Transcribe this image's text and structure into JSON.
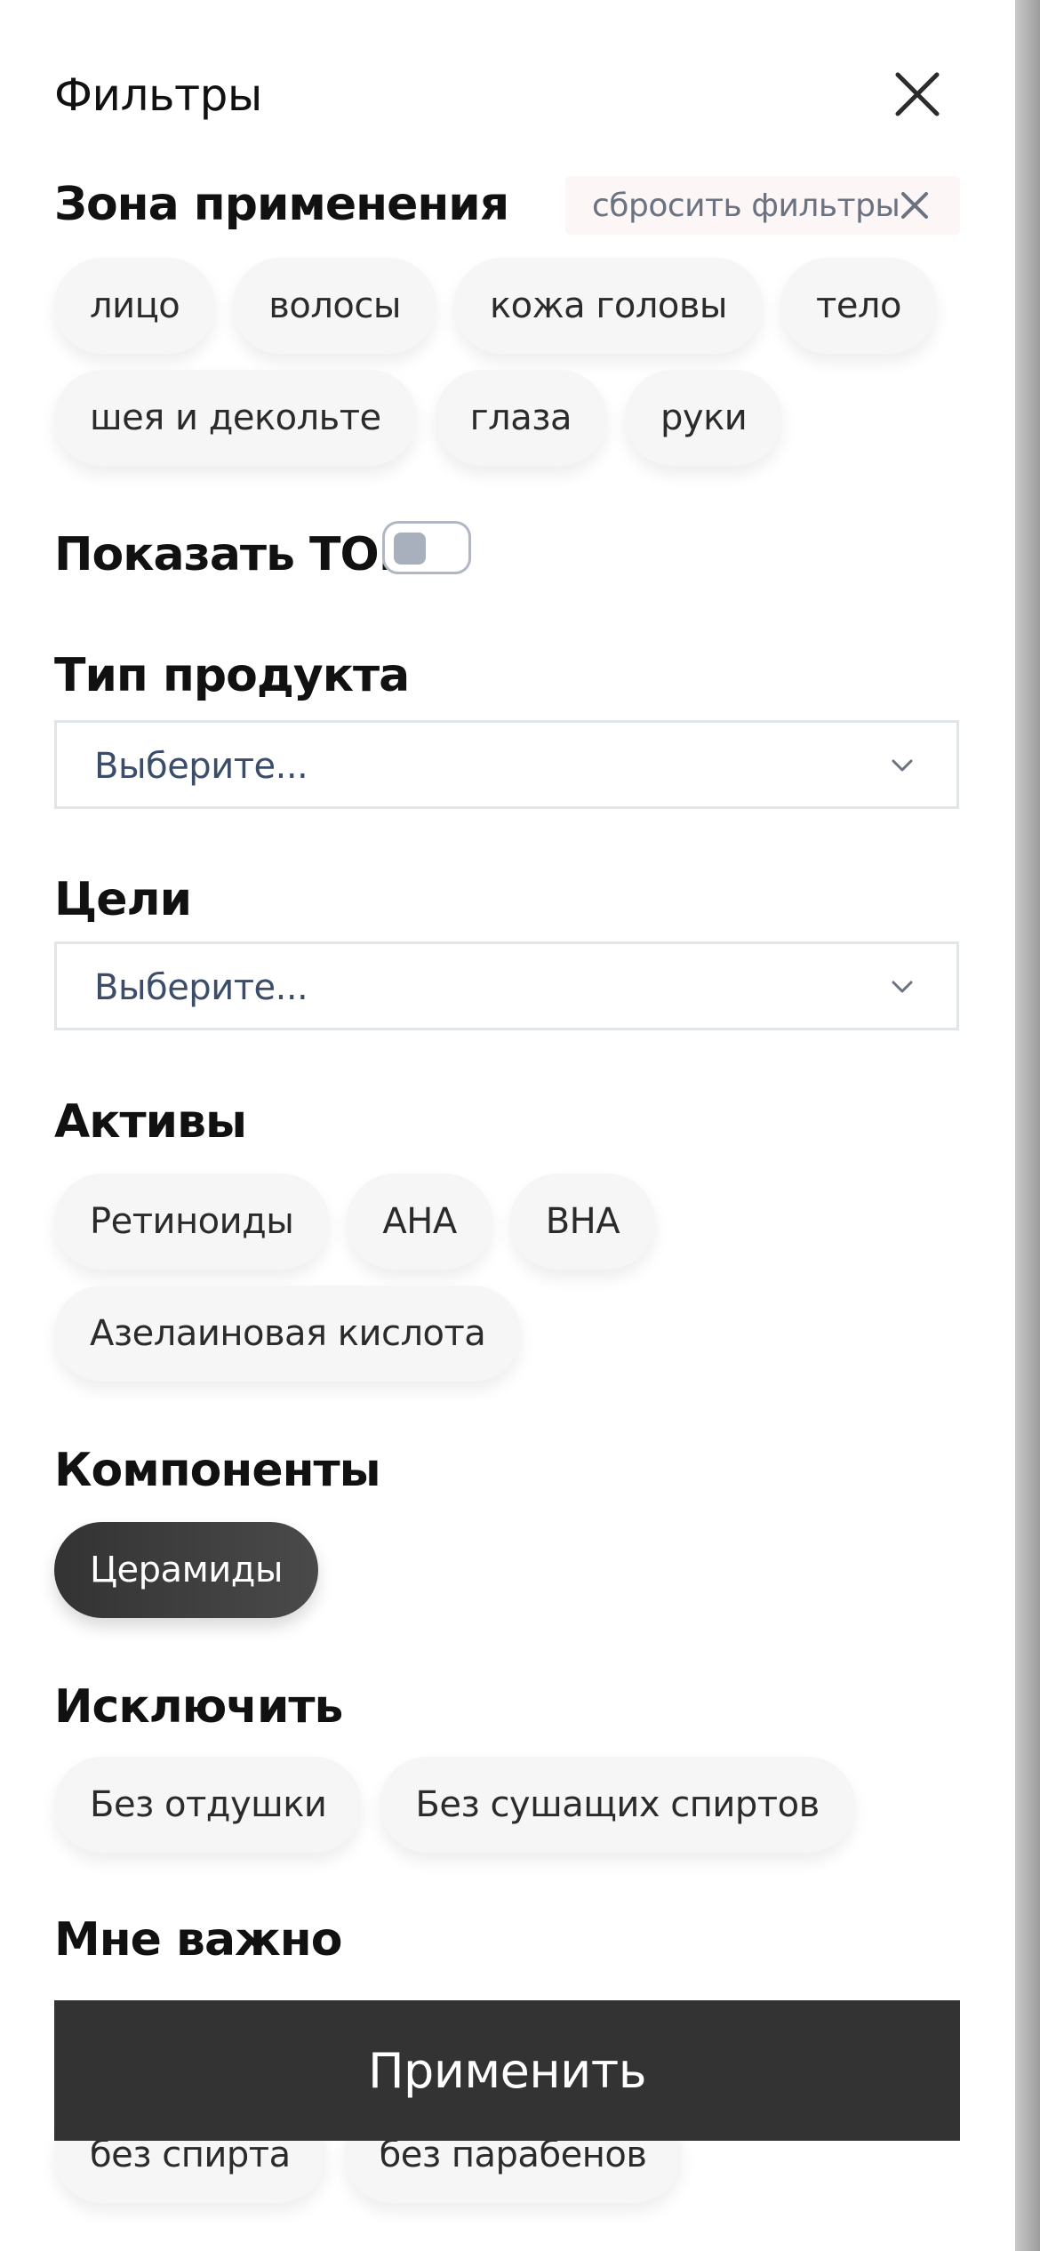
{
  "header": {
    "title": "Фильтры"
  },
  "reset_filters": {
    "label": "сбросить фильтры"
  },
  "zone": {
    "title": "Зона применения",
    "chips": [
      "лицо",
      "волосы",
      "кожа головы",
      "тело",
      "шея и декольте",
      "глаза",
      "руки"
    ]
  },
  "top": {
    "label": "Показать ТОП",
    "checked": false
  },
  "product_type": {
    "title": "Тип продукта",
    "placeholder": "Выберите..."
  },
  "goals": {
    "title": "Цели",
    "placeholder": "Выберите..."
  },
  "actives": {
    "title": "Активы",
    "chips": [
      "Ретиноиды",
      "AHA",
      "BHA",
      "Азелаиновая кислота"
    ]
  },
  "components": {
    "title": "Компоненты",
    "chips": [
      "Церамиды"
    ],
    "selected": "Церамиды"
  },
  "exclude": {
    "title": "Исключить",
    "chips": [
      "Без отдушки",
      "Без сушащих спиртов"
    ]
  },
  "important": {
    "title": "Мне важно",
    "chips": [
      "без спирта",
      "без парабенов"
    ]
  },
  "apply_button": {
    "label": "Применить"
  },
  "colors": {
    "chip_bg": "#f6f6f6",
    "chip_active_bg": "#3a3a3a",
    "apply_bg": "#333333",
    "reset_bg": "#fcf6f6",
    "select_text": "#3b4d6b"
  },
  "icons": {
    "close": "close-icon",
    "reset": "close-icon",
    "select": "chevron-down-icon"
  }
}
